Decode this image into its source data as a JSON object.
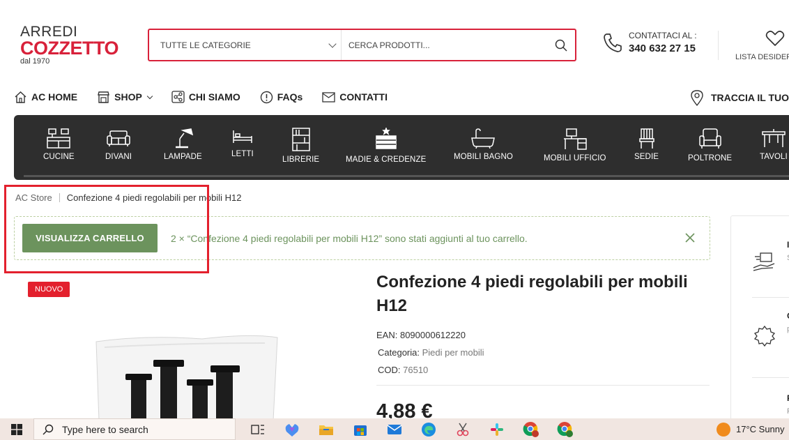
{
  "header": {
    "logo": {
      "line1": "ARREDI",
      "line2": "COZZETTO",
      "line3": "dal 1970"
    },
    "search": {
      "category_label": "TUTTE LE CATEGORIE",
      "placeholder": "CERCA PRODOTTI..."
    },
    "contact": {
      "label": "CONTATTACI AL :",
      "phone": "340 632 27 15"
    },
    "wishlist_label": "LISTA DESIDERI"
  },
  "nav": {
    "items": [
      {
        "label": "AC HOME",
        "icon": "home-icon"
      },
      {
        "label": "SHOP",
        "icon": "shop-icon"
      },
      {
        "label": "CHI SIAMO",
        "icon": "share-icon"
      },
      {
        "label": "FAQs",
        "icon": "info-icon"
      },
      {
        "label": "CONTATTI",
        "icon": "mail-icon"
      }
    ],
    "track_label": "TRACCIA IL TUO O"
  },
  "categories": [
    {
      "label": "CUCINE",
      "icon": "kitchen-icon"
    },
    {
      "label": "DIVANI",
      "icon": "sofa-icon"
    },
    {
      "label": "LAMPADE",
      "icon": "lamp-icon"
    },
    {
      "label": "LETTI",
      "icon": "bed-icon"
    },
    {
      "label": "LIBRERIE",
      "icon": "bookcase-icon"
    },
    {
      "label": "MADIE & CREDENZE",
      "icon": "sideboard-icon"
    },
    {
      "label": "MOBILI BAGNO",
      "icon": "bathtub-icon"
    },
    {
      "label": "MOBILI UFFICIO",
      "icon": "desk-icon"
    },
    {
      "label": "SEDIE",
      "icon": "chair-icon"
    },
    {
      "label": "POLTRONE",
      "icon": "armchair-icon"
    },
    {
      "label": "TAVOLI",
      "icon": "table-icon"
    }
  ],
  "breadcrumb": {
    "home": "AC Store",
    "current": "Confezione 4 piedi regolabili per mobili H12"
  },
  "notice": {
    "button_label": "VISUALIZZA CARRELLO",
    "message": "2 × “Confezione 4 piedi regolabili per mobili H12” sono stati aggiunti al tuo carrello."
  },
  "product": {
    "badge": "NUOVO",
    "title": "Confezione 4 piedi regolabili per mobili H12",
    "ean_label": "EAN:",
    "ean": "8090000612220",
    "category_label": "Categoria:",
    "category": "Piedi per mobili",
    "cod_label": "COD:",
    "cod": "76510",
    "price": "4,88 €"
  },
  "sidebar": {
    "items": [
      {
        "title": "I",
        "sub": "S"
      },
      {
        "title": "C",
        "sub": "p"
      },
      {
        "title": "F",
        "sub": "F"
      }
    ]
  },
  "taskbar": {
    "search_placeholder": "Type here to search",
    "weather": "17°C  Sunny",
    "apps": [
      "task-view-icon",
      "copilot-icon",
      "file-explorer-icon",
      "store-icon",
      "mail-icon",
      "edge-icon",
      "snipping-tool-icon",
      "slack-icon",
      "chrome-icon",
      "chrome-profile-icon"
    ]
  },
  "colors": {
    "brand": "#d8213a",
    "notice_green": "#6c935d",
    "category_bar": "#2e2e2e",
    "highlight": "#e3202d"
  }
}
